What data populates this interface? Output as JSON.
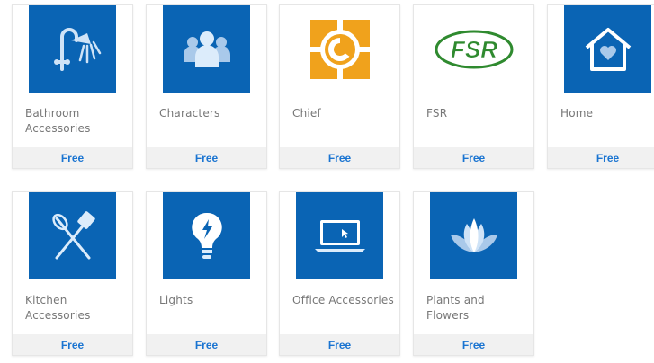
{
  "gallery": {
    "items": [
      {
        "title": "Bathroom Accessories",
        "price": "Free",
        "icon": "shower-icon",
        "thumb_bg": "#0a64b4"
      },
      {
        "title": "Characters",
        "price": "Free",
        "icon": "people-icon",
        "thumb_bg": "#0a64b4"
      },
      {
        "title": "Chief",
        "price": "Free",
        "icon": "chief-logo-icon",
        "thumb_bg": "#ffffff",
        "logo_color": "#f0a21c"
      },
      {
        "title": "FSR",
        "price": "Free",
        "icon": "fsr-logo-icon",
        "thumb_bg": "#ffffff",
        "logo_text": "FSR",
        "logo_color": "#2f8a2f"
      },
      {
        "title": "Home",
        "price": "Free",
        "icon": "home-heart-icon",
        "thumb_bg": "#0a64b4"
      },
      {
        "title": "Kitchen Accessories",
        "price": "Free",
        "icon": "kitchen-utensils-icon",
        "thumb_bg": "#0a64b4"
      },
      {
        "title": "Lights",
        "price": "Free",
        "icon": "lightbulb-icon",
        "thumb_bg": "#0a64b4"
      },
      {
        "title": "Office Accessories",
        "price": "Free",
        "icon": "laptop-icon",
        "thumb_bg": "#0a64b4"
      },
      {
        "title": "Plants and Flowers",
        "price": "Free",
        "icon": "lotus-icon",
        "thumb_bg": "#0a64b4"
      }
    ]
  },
  "colors": {
    "accent": "#1a74d1",
    "tile_blue": "#0a64b4",
    "footer_bg": "#f1f1f1"
  }
}
